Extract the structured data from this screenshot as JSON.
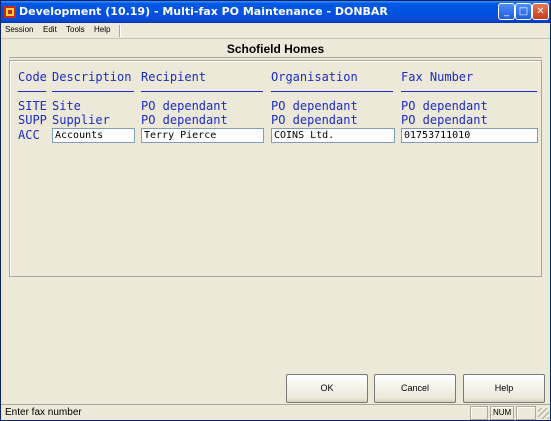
{
  "window": {
    "title": "Development (10.19) - Multi-fax PO Maintenance - DONBAR",
    "minimize_label": "_",
    "maximize_label": "□",
    "close_label": "✕"
  },
  "menu": {
    "items": [
      "Session",
      "Edit",
      "Tools",
      "Help"
    ]
  },
  "heading": "Schofield Homes",
  "table": {
    "columns": [
      "Code",
      "Description",
      "Recipient",
      "Organisation",
      "Fax Number"
    ],
    "rows": [
      {
        "code": "SITE",
        "description": "Site",
        "recipient": "PO dependant",
        "organisation": "PO dependant",
        "fax": "PO dependant"
      },
      {
        "code": "SUPP",
        "description": "Supplier",
        "recipient": "PO dependant",
        "organisation": "PO dependant",
        "fax": "PO dependant"
      },
      {
        "code": "ACC",
        "description": "Accounts",
        "recipient": "Terry Pierce",
        "organisation": "COINS Ltd.",
        "fax": "01753711010"
      }
    ]
  },
  "buttons": {
    "ok": "OK",
    "cancel": "Cancel",
    "help": "Help"
  },
  "status": {
    "message": "Enter fax number",
    "num": "NUM"
  },
  "colors": {
    "titlebar": "#0053e1",
    "field_text": "#1c2bce",
    "face": "#ece9d8"
  }
}
